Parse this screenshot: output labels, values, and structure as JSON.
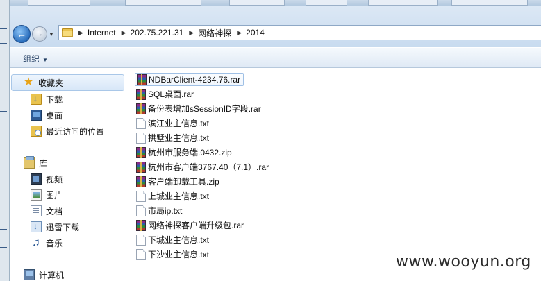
{
  "address_bar": {
    "breadcrumbs": [
      "Internet",
      "202.75.221.31",
      "网络神探",
      "2014"
    ]
  },
  "toolbar": {
    "organize_label": "组织"
  },
  "nav_pane": {
    "favorites_label": "收藏夹",
    "favorites_items": [
      {
        "label": "下载",
        "icon": "downloads-folder-icon"
      },
      {
        "label": "桌面",
        "icon": "desktop-icon"
      },
      {
        "label": "最近访问的位置",
        "icon": "recent-places-icon"
      }
    ],
    "libraries_label": "库",
    "libraries_items": [
      {
        "label": "视频",
        "icon": "videos-icon"
      },
      {
        "label": "图片",
        "icon": "pictures-icon"
      },
      {
        "label": "文档",
        "icon": "documents-icon"
      },
      {
        "label": "迅雷下载",
        "icon": "thunder-download-icon"
      },
      {
        "label": "音乐",
        "icon": "music-icon"
      }
    ],
    "computer_label": "计算机"
  },
  "files": [
    {
      "name": "NDBarClient-4234.76.rar",
      "type": "rar",
      "selected": true
    },
    {
      "name": "SQL桌面.rar",
      "type": "rar"
    },
    {
      "name": "备份表增加sSessionID字段.rar",
      "type": "rar"
    },
    {
      "name": "滨江业主信息.txt",
      "type": "txt"
    },
    {
      "name": "拱墅业主信息.txt",
      "type": "txt"
    },
    {
      "name": "杭州市服务端.0432.zip",
      "type": "rar"
    },
    {
      "name": "杭州市客户端3767.40（7.1）.rar",
      "type": "rar"
    },
    {
      "name": "客户端卸载工具.zip",
      "type": "rar"
    },
    {
      "name": "上城业主信息.txt",
      "type": "txt"
    },
    {
      "name": "市局ip.txt",
      "type": "txt"
    },
    {
      "name": "网络神探客户端升级包.rar",
      "type": "rar"
    },
    {
      "name": "下城业主信息.txt",
      "type": "txt"
    },
    {
      "name": "下沙业主信息.txt",
      "type": "txt"
    }
  ],
  "watermark": "www.wooyun.org"
}
